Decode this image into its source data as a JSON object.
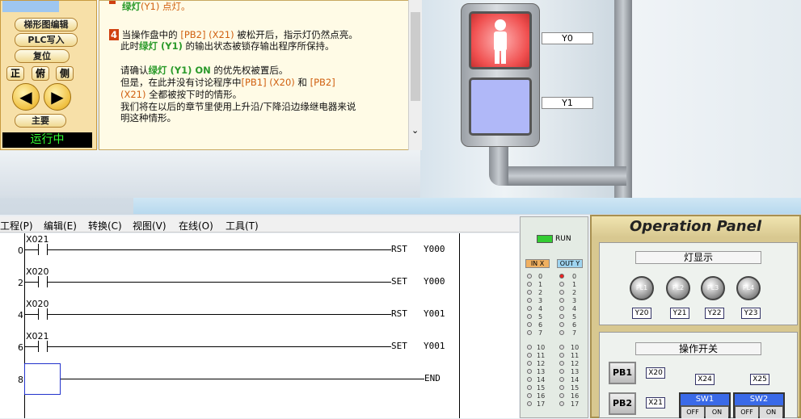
{
  "left_panel": {
    "buttons": [
      "梯形图编辑",
      "PLC写入",
      "复位"
    ],
    "view_buttons": [
      "正",
      "俯",
      "侧"
    ],
    "main": "主要",
    "status": "运行中"
  },
  "text": {
    "l1a": "绿灯",
    "l1b": "(Y1) 点灯。",
    "step": "4",
    "l2a": "当操作盘中的 ",
    "l2b": "[PB2] (X21)",
    "l2c": " 被松开后，指示灯仍然点亮。",
    "l3a": "此时",
    "l3b": "绿灯 (Y1)",
    "l3c": " 的输出状态被锁存输出程序所保持。",
    "l4a": "请确认",
    "l4b": "绿灯 (Y1) ON",
    "l4c": " 的优先权被置后。",
    "l5a": "但是，在此并没有讨论程序中",
    "l5b": "[PB1] (X20)",
    "l5c": " 和 ",
    "l5d": "[PB2]",
    "l6a": "(X21)",
    "l6b": " 全都被按下时的情形。",
    "l7": "我们将在以后的章节里使用上升沿/下降沿边缘继电器来说",
    "l8": "明这种情形。"
  },
  "signal": {
    "y0": "Y0",
    "y1": "Y1"
  },
  "menu": [
    "工程(P)",
    "编辑(E)",
    "转换(C)",
    "视图(V)",
    "在线(O)",
    "工具(T)"
  ],
  "ladder": [
    {
      "step": "0",
      "contact": "X021",
      "instr": "RST",
      "dev": "Y000"
    },
    {
      "step": "2",
      "contact": "X020",
      "instr": "SET",
      "dev": "Y000"
    },
    {
      "step": "4",
      "contact": "X020",
      "instr": "RST",
      "dev": "Y001"
    },
    {
      "step": "6",
      "contact": "X021",
      "instr": "SET",
      "dev": "Y001"
    },
    {
      "step": "8",
      "contact": "",
      "instr": "END",
      "dev": ""
    }
  ],
  "io": {
    "run": "RUN",
    "in": "IN X",
    "out": "OUT Y",
    "nums": [
      "0",
      "1",
      "2",
      "3",
      "4",
      "5",
      "6",
      "7",
      "10",
      "11",
      "12",
      "13",
      "14",
      "15",
      "16",
      "17"
    ]
  },
  "op": {
    "title": "Operation Panel",
    "lamp_title": "灯显示",
    "switch_title": "操作开关",
    "lamps": [
      "PL1",
      "PL2",
      "PL3",
      "PL4"
    ],
    "lamp_out": [
      "Y20",
      "Y21",
      "Y22",
      "Y23"
    ],
    "pb": [
      "PB1",
      "PB2"
    ],
    "pb_in": [
      "X20",
      "X21"
    ],
    "sw_in": [
      "X24",
      "X25"
    ],
    "sw": [
      "SW1",
      "SW2"
    ],
    "off": "OFF",
    "on": "ON"
  }
}
